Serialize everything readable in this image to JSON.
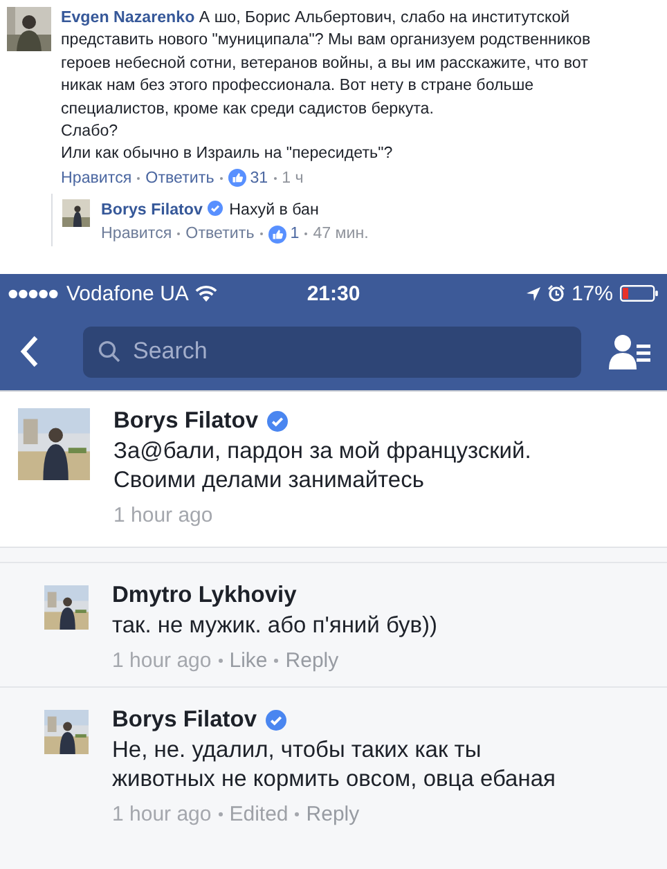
{
  "desktop_thread": {
    "comment": {
      "author": "Evgen Nazarenko",
      "paragraphs": [
        "А шо, Борис Альбертович, слабо на институтской представить нового \"муниципала\"? Мы вам организуем родственников героев небесной сотни, ветеранов войны, а вы им расскажите, что вот никак нам без этого профессионала. Вот нету в стране больше специалистов, кроме как среди садистов беркута.",
        "Слабо?",
        "Или как обычно в Израиль на \"пересидеть\"?"
      ],
      "actions": [
        {
          "kind": "link",
          "text": "Нравится"
        },
        {
          "kind": "link",
          "text": "Ответить"
        },
        {
          "kind": "likes",
          "text": "31"
        },
        {
          "kind": "time",
          "text": "1 ч"
        }
      ]
    },
    "reply": {
      "author": "Borys Filatov",
      "verified": true,
      "text": "Нахуй в бан",
      "actions": [
        {
          "kind": "link",
          "text": "Нравится"
        },
        {
          "kind": "link",
          "text": "Ответить"
        },
        {
          "kind": "likes",
          "text": "1"
        },
        {
          "kind": "time",
          "text": "47 мин."
        }
      ]
    }
  },
  "status_bar": {
    "carrier": "Vodafone UA",
    "time": "21:30",
    "battery": "17%"
  },
  "nav": {
    "search": {
      "placeholder": "Search"
    }
  },
  "comments": [
    {
      "kind": "comment",
      "author": "Borys Filatov",
      "verified": true,
      "lines": [
        "За@бали, пардон за мой французский.",
        "Своими делами занимайтесь"
      ],
      "meta": [
        {
          "kind": "time",
          "text": "1 hour ago"
        }
      ]
    },
    {
      "kind": "reply",
      "author": "Dmytro Lykhoviy",
      "verified": false,
      "lines": [
        "так. не мужик. або п'яний був))"
      ],
      "meta": [
        {
          "kind": "time",
          "text": "1 hour ago"
        },
        {
          "kind": "link",
          "text": "Like"
        },
        {
          "kind": "link",
          "text": "Reply"
        }
      ]
    },
    {
      "kind": "reply",
      "author": "Borys Filatov",
      "verified": true,
      "lines": [
        "Не, не. удалил, чтобы таких как ты",
        "животных не кормить овсом, овца ебаная"
      ],
      "meta": [
        {
          "kind": "time",
          "text": "1 hour ago"
        },
        {
          "kind": "status",
          "text": "Edited"
        },
        {
          "kind": "link",
          "text": "Reply"
        }
      ]
    }
  ]
}
